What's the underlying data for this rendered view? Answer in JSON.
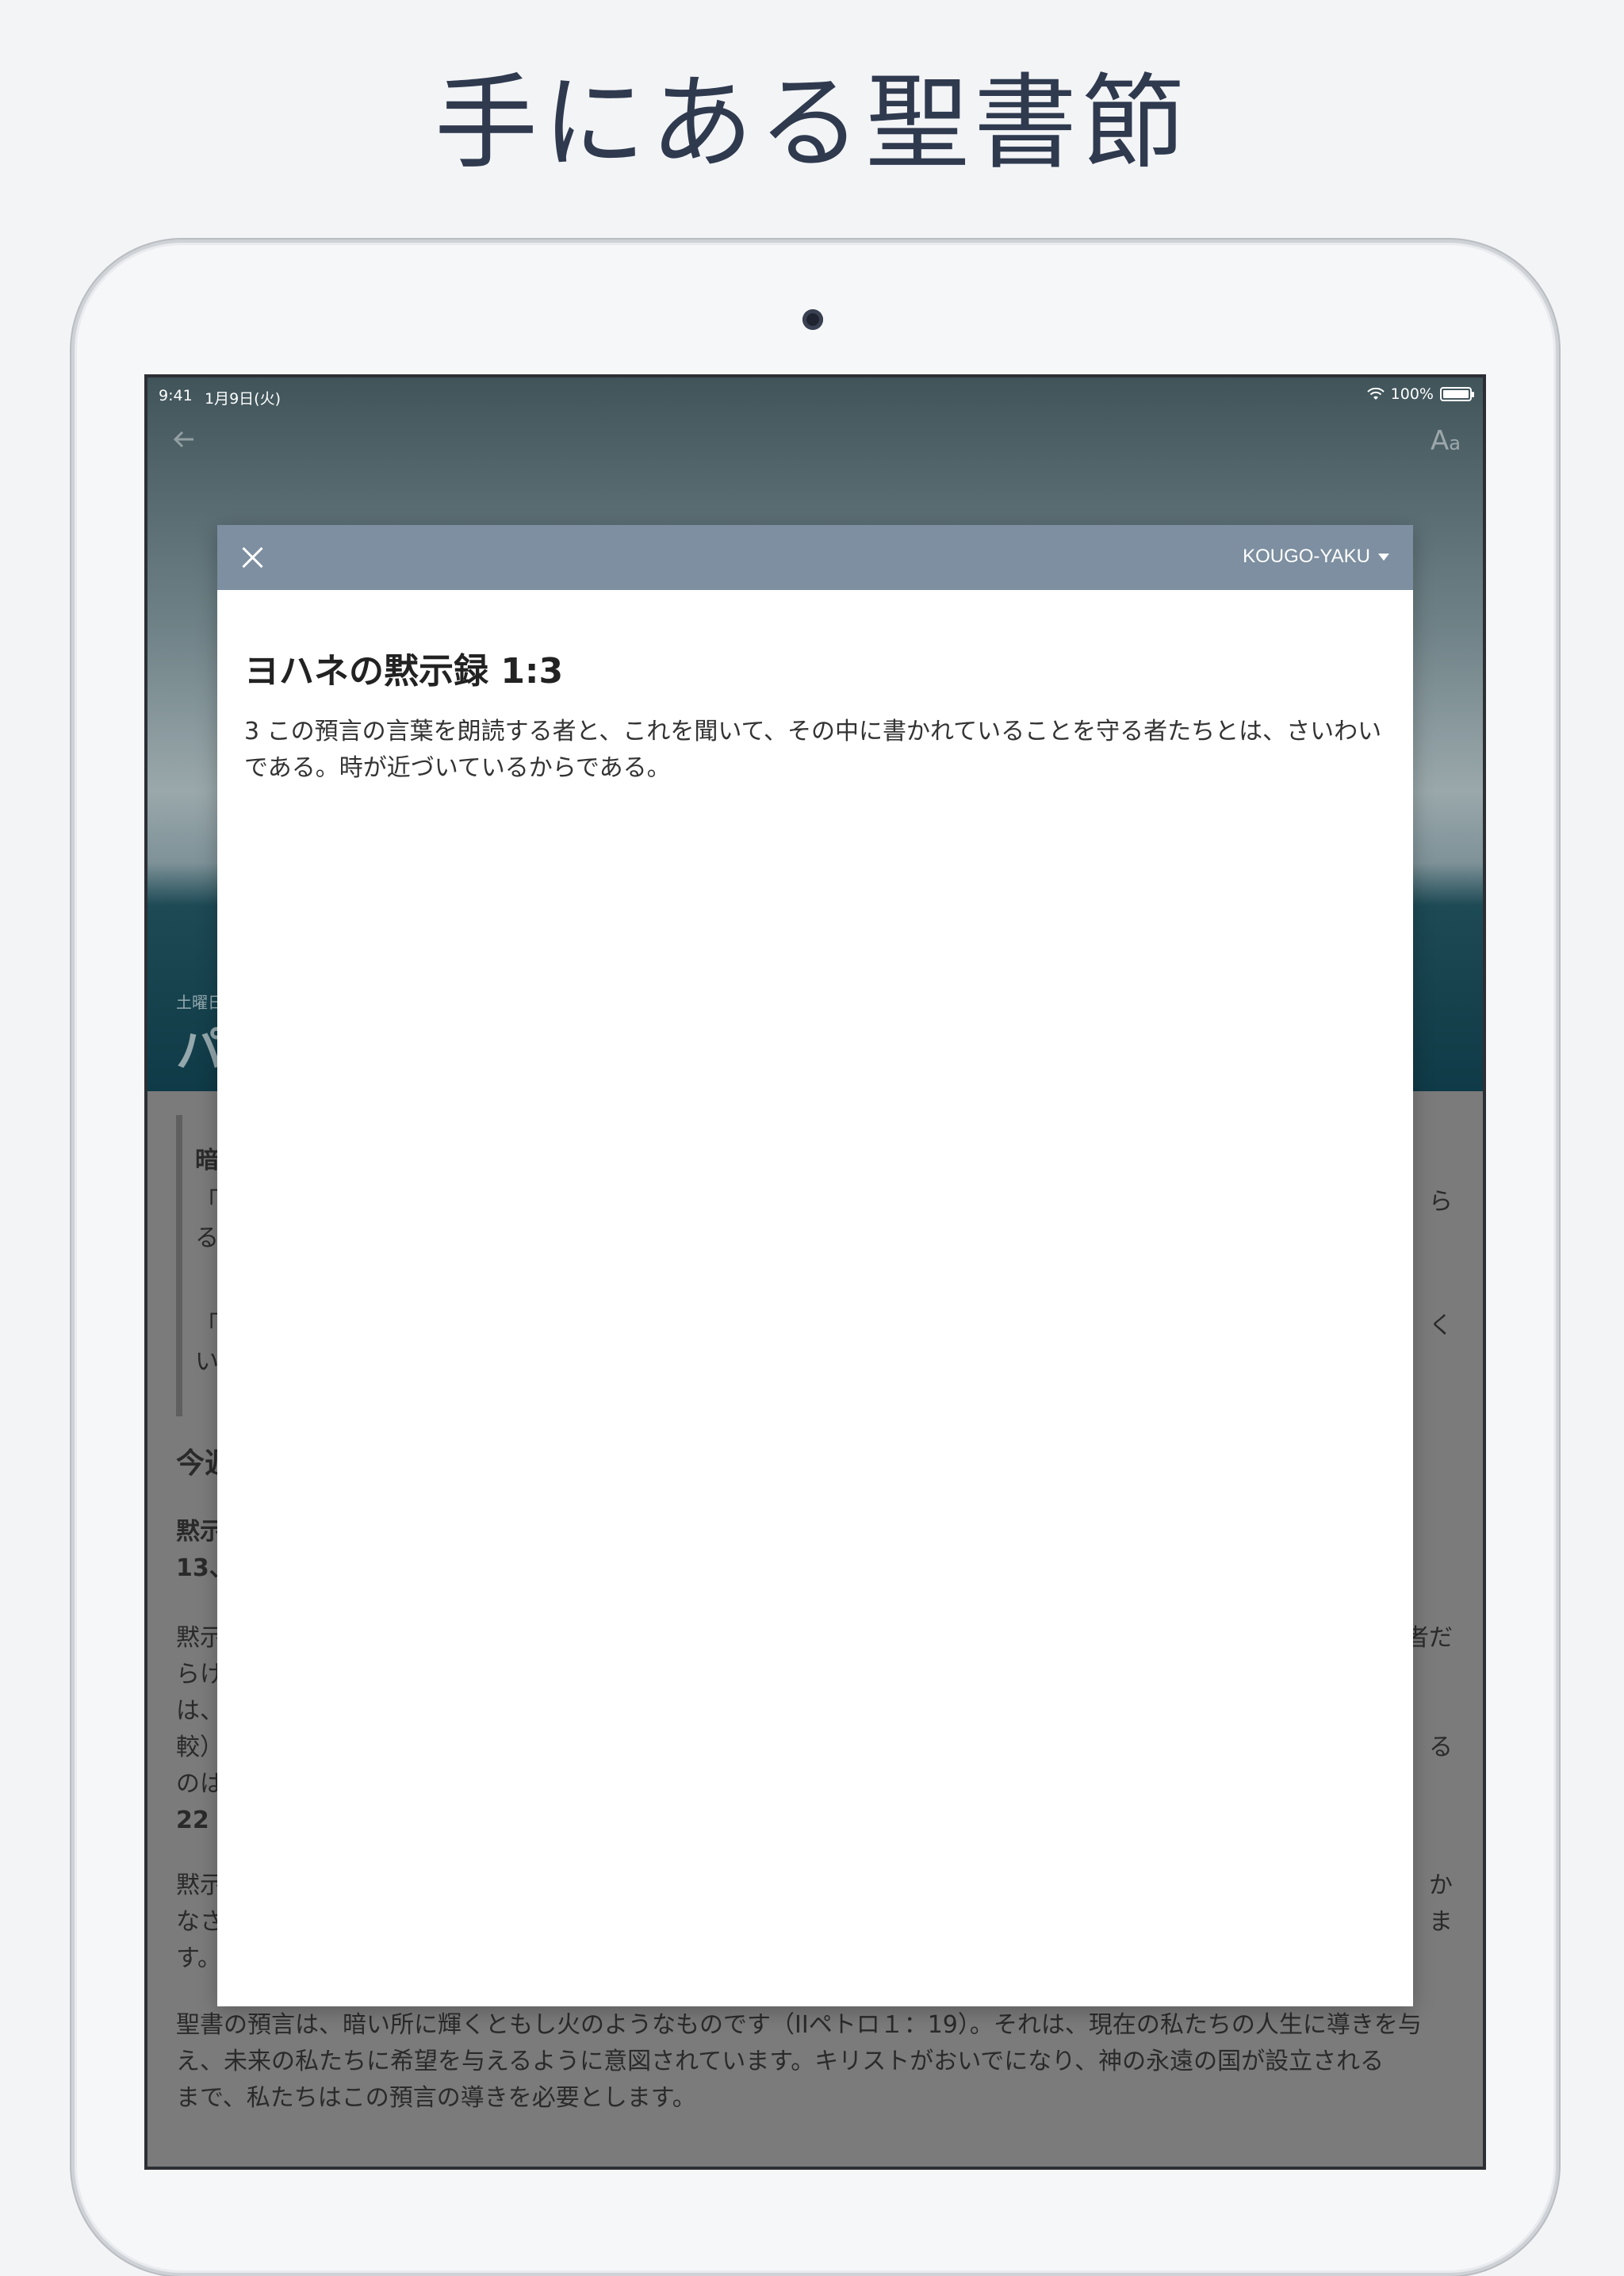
{
  "headline": "手にある聖書節",
  "status_bar": {
    "time": "9:41",
    "date": "1月9日(火)",
    "battery": "100%"
  },
  "background": {
    "day_label": "土曜日",
    "title_fragment": "パ",
    "text_lines": [
      {
        "left": "暗",
        "right": ""
      },
      {
        "left": "「",
        "right": "ら"
      },
      {
        "left": "る",
        "right": ""
      },
      {
        "left": "「",
        "right": "く"
      },
      {
        "left": "い",
        "right": ""
      }
    ],
    "section_heading": "今週",
    "link_line": "黙示",
    "link_line2": "13、",
    "para1": [
      "黙示",
      "らけ",
      "は、",
      "較）",
      "のは",
      "22"
    ],
    "para1_right": [
      "者だ",
      "",
      "",
      "る",
      "",
      ""
    ],
    "para2": [
      "黙示",
      "なさ",
      "す。"
    ],
    "para2_right": [
      "か",
      "ま",
      ""
    ],
    "bottom_lines": [
      "聖書の預言は、暗い所に輝くともし火のようなものです（IIペトロ１：19）。それは、現在の私たちの人生に導きを与",
      "え、未来の私たちに希望を与えるように意図されています。キリストがおいでになり、神の永遠の国が設立される",
      "まで、私たちはこの預言の導きを必要とします。"
    ]
  },
  "modal": {
    "version": "KOUGO-YAKU",
    "reference": "ヨハネの黙示録 1:3",
    "verse_text": "3 この預言の言葉を朗読する者と、これを聞いて、その中に書かれていることを守る者たちとは、さいわいである。時が近づいているからである。"
  },
  "icons": {
    "close": "close-icon",
    "back": "arrow-left-icon",
    "font_size": "font-size-icon",
    "caret": "caret-down-icon",
    "wifi": "wifi-icon",
    "battery": "battery-icon"
  },
  "colors": {
    "headline": "#2f3a4f",
    "modal_bar": "#7d8fa0",
    "page_bg": "#f3f4f6"
  }
}
